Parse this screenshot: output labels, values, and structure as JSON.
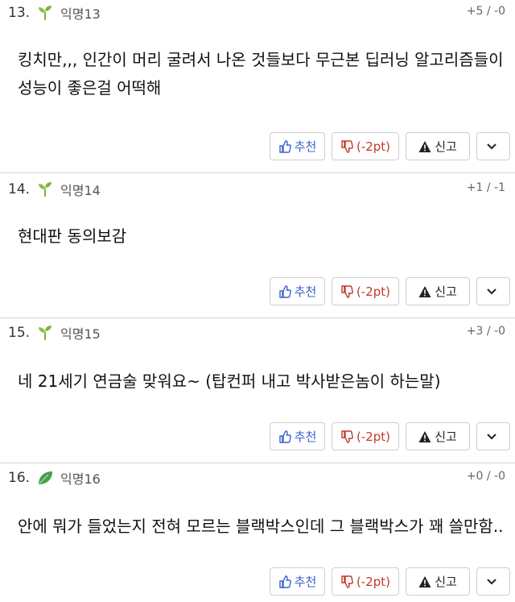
{
  "comments": [
    {
      "number": "13.",
      "nickname": "익명13",
      "votes": "+5 / -0",
      "text_lines": [
        "킹치만,,, 인간이 머리 굴려서 나온 것들보다 무근본 딥러닝 알고리즘들이",
        "성능이 좋은걸 어떡해"
      ],
      "leaf": "sprout-icon"
    },
    {
      "number": "14.",
      "nickname": "익명14",
      "votes": "+1 / -1",
      "text_lines": [
        "현대판 동의보감"
      ],
      "leaf": "sprout-icon"
    },
    {
      "number": "15.",
      "nickname": "익명15",
      "votes": "+3 / -0",
      "text_lines": [
        "네 21세기 연금술 맞워요~ (탑컨퍼 내고 박사받은놈이 하는말)"
      ],
      "leaf": "sprout-icon"
    },
    {
      "number": "16.",
      "nickname": "익명16",
      "votes": "+0 / -0",
      "text_lines": [
        "안에 뭐가 들었는지 전혀 모르는 블랙박스인데 그 블랙박스가 꽤 쓸만함.."
      ],
      "leaf": "leaf-icon"
    }
  ],
  "actions": {
    "upvote_label": "추천",
    "downvote_label": "(-2pt)",
    "report_label": "신고"
  },
  "colors": {
    "upvote": "#3a63c9",
    "downvote": "#c0392b",
    "sprout": "#7cb342",
    "leaf": "#43a047"
  }
}
